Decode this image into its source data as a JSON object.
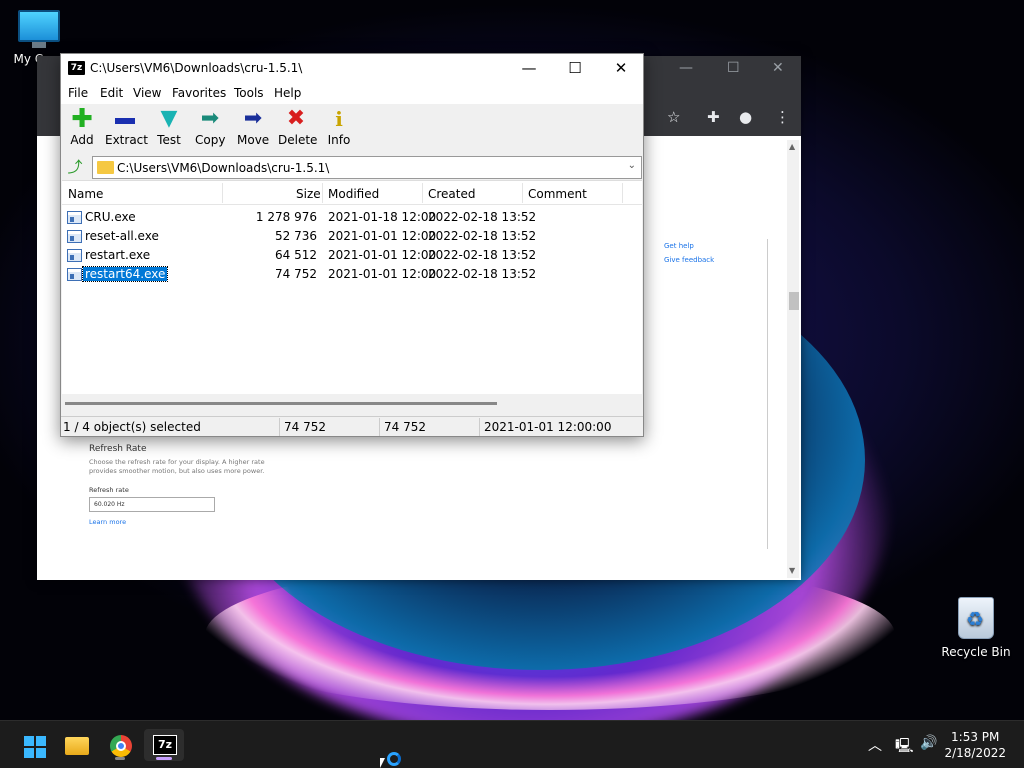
{
  "desktop": {
    "icons": [
      {
        "label": "My Co"
      },
      {
        "label": "Recycle Bin"
      }
    ]
  },
  "browser": {
    "side_links": [
      "Get help",
      "Give feedback"
    ],
    "refresh_rate": {
      "title": "Refresh Rate",
      "description": "Choose the refresh rate for your display. A higher rate provides smoother motion, but also uses more power.",
      "label": "Refresh rate",
      "value": "60.020 Hz",
      "link": "Learn more"
    }
  },
  "sevenzip": {
    "title": "C:\\Users\\VM6\\Downloads\\cru-1.5.1\\",
    "app_icon": "7z",
    "menu": [
      "File",
      "Edit",
      "View",
      "Favorites",
      "Tools",
      "Help"
    ],
    "toolbar": [
      {
        "label": "Add",
        "icon": "plus-icon",
        "color": "#22b022"
      },
      {
        "label": "Extract",
        "icon": "minus-icon",
        "color": "#1a2fb0"
      },
      {
        "label": "Test",
        "icon": "check-icon",
        "color": "#19b3b3"
      },
      {
        "label": "Copy",
        "icon": "arrow-right-icon",
        "color": "#1a8a7a"
      },
      {
        "label": "Move",
        "icon": "arrow-right-icon",
        "color": "#1a2f9a"
      },
      {
        "label": "Delete",
        "icon": "x-icon",
        "color": "#d81e1e"
      },
      {
        "label": "Info",
        "icon": "info-icon",
        "color": "#c9a400"
      }
    ],
    "address": "C:\\Users\\VM6\\Downloads\\cru-1.5.1\\",
    "columns": [
      "Name",
      "Size",
      "Modified",
      "Created",
      "Comment"
    ],
    "rows": [
      {
        "name": "CRU.exe",
        "size": "1 278 976",
        "modified": "2021-01-18 12:00",
        "created": "2022-02-18 13:52",
        "comment": ""
      },
      {
        "name": "reset-all.exe",
        "size": "52 736",
        "modified": "2021-01-01 12:00",
        "created": "2022-02-18 13:52",
        "comment": ""
      },
      {
        "name": "restart.exe",
        "size": "64 512",
        "modified": "2021-01-01 12:00",
        "created": "2022-02-18 13:52",
        "comment": ""
      },
      {
        "name": "restart64.exe",
        "size": "74 752",
        "modified": "2021-01-01 12:00",
        "created": "2022-02-18 13:52",
        "comment": "",
        "selected": true
      }
    ],
    "status": {
      "selection": "1 / 4 object(s) selected",
      "size": "74 752",
      "packed": "74 752",
      "date": "2021-01-01 12:00:00"
    }
  },
  "taskbar": {
    "apps": [
      {
        "name": "Start"
      },
      {
        "name": "File Explorer"
      },
      {
        "name": "Google Chrome"
      },
      {
        "name": "7-Zip",
        "glyph": "7z"
      }
    ],
    "clock": {
      "time": "1:53 PM",
      "date": "2/18/2022"
    }
  }
}
